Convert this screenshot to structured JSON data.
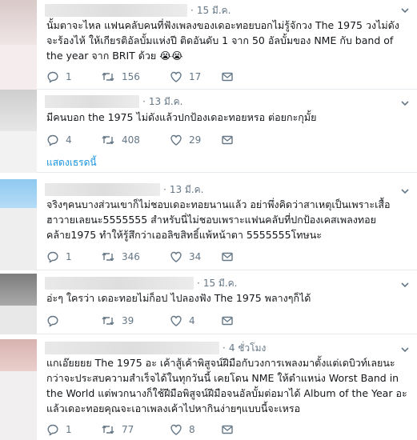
{
  "colors": {
    "link": "#1b95e0",
    "muted": "#657786",
    "divider": "#e6ecf0"
  },
  "icons": [
    "reply-icon",
    "retweet-icon",
    "like-icon",
    "dm-icon",
    "chevron-down-icon"
  ],
  "tweets": [
    {
      "time": "15 มี.ค.",
      "text": "นั้มตาจะไหล แฟนคลับคนที่ฟังเพลงของเดอะทอยบอกไม่รู้จักวง The 1975 วงไม่ดัง จะร้องไห้ ให้เกียรติอัลบั้มแห่งปี ติดอันดับ 1 จาก 50 อัลบั้มของ NME กับ band of the year จาก BRIT ด้วย 😭😭",
      "replies": "1",
      "retweets": "156",
      "likes": "17"
    },
    {
      "time": "13 มี.ค.",
      "text": "มีคนบอก the 1975 ไม่ดังแล้วปกป้องเดอะทอยหรอ ต่อยกะกุมั้ย",
      "replies": "4",
      "retweets": "408",
      "likes": "29",
      "show_thread": "แสดงเธรดนี้"
    },
    {
      "time": "13 มี.ค.",
      "text": "จริงๆคนบางส่วนเขาก็ไม่ชอบเดอะทอยนานแล้ว อย่าพึ่งคิดว่าสาเหตุเป็นเพราะเสื้อฮาวายเลยนะ5555555 สำหรับนี่ไม่ชอบเพราะแฟนคลับที่ปกป้องเคสเพลงทอยคล้าย1975 ทำให้รู้สึกว่าเออลิขสิทธิ์แพ้หน้าตา 5555555โทษนะ",
      "replies": "1",
      "retweets": "346",
      "likes": "34"
    },
    {
      "time": "15 มี.ค.",
      "text": "อ่ะๆ ใครว่า เดอะทอยไม่ก็อป ไปลองฟัง The 1975 พลางๆก็ได้",
      "replies": "",
      "retweets": "39",
      "likes": "4"
    },
    {
      "time": "4 ชั่วโมง",
      "text": "แกเอ๊ยยยย The 1975 อะ เค้าสู้เค้าพิสูจน์ฝีมือกับวงการเพลงมาตั้งแต่เดบิวท์เลยนะกว่าจะประสบความสำเร็จได้ในทุกวันนี้ เคยโดน NME ให้ตำแหน่ง Worst Band in the World แต่พวกนางก็ใช้ฝีมือพิสูจน์ฝีมือจนอัลบั้มต่อมาได้ Album of the Year อะ แล้วเดอะทอยคุณจะเอาเพลงเค้าไปหากินง่ายๆแบบนี้จะเหรอ",
      "replies": "1",
      "retweets": "77",
      "likes": "8"
    }
  ]
}
